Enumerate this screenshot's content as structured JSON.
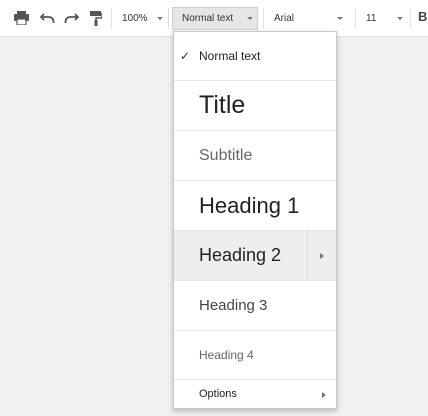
{
  "toolbar": {
    "zoom_value": "100%",
    "style_value": "Normal text",
    "font_value": "Arial",
    "size_value": "11",
    "bold_label": "B"
  },
  "style_menu": {
    "items": [
      {
        "label": "Normal text",
        "checked": true
      },
      {
        "label": "Title"
      },
      {
        "label": "Subtitle"
      },
      {
        "label": "Heading 1"
      },
      {
        "label": "Heading 2",
        "has_submenu": true,
        "hovered": true
      },
      {
        "label": "Heading 3"
      },
      {
        "label": "Heading 4"
      },
      {
        "label": "Options",
        "has_submenu": true
      }
    ]
  },
  "colors": {
    "hover_bg": "#eeeeee",
    "canvas_bg": "#f1f1f1",
    "active_field_bg": "#e6e6e6"
  }
}
